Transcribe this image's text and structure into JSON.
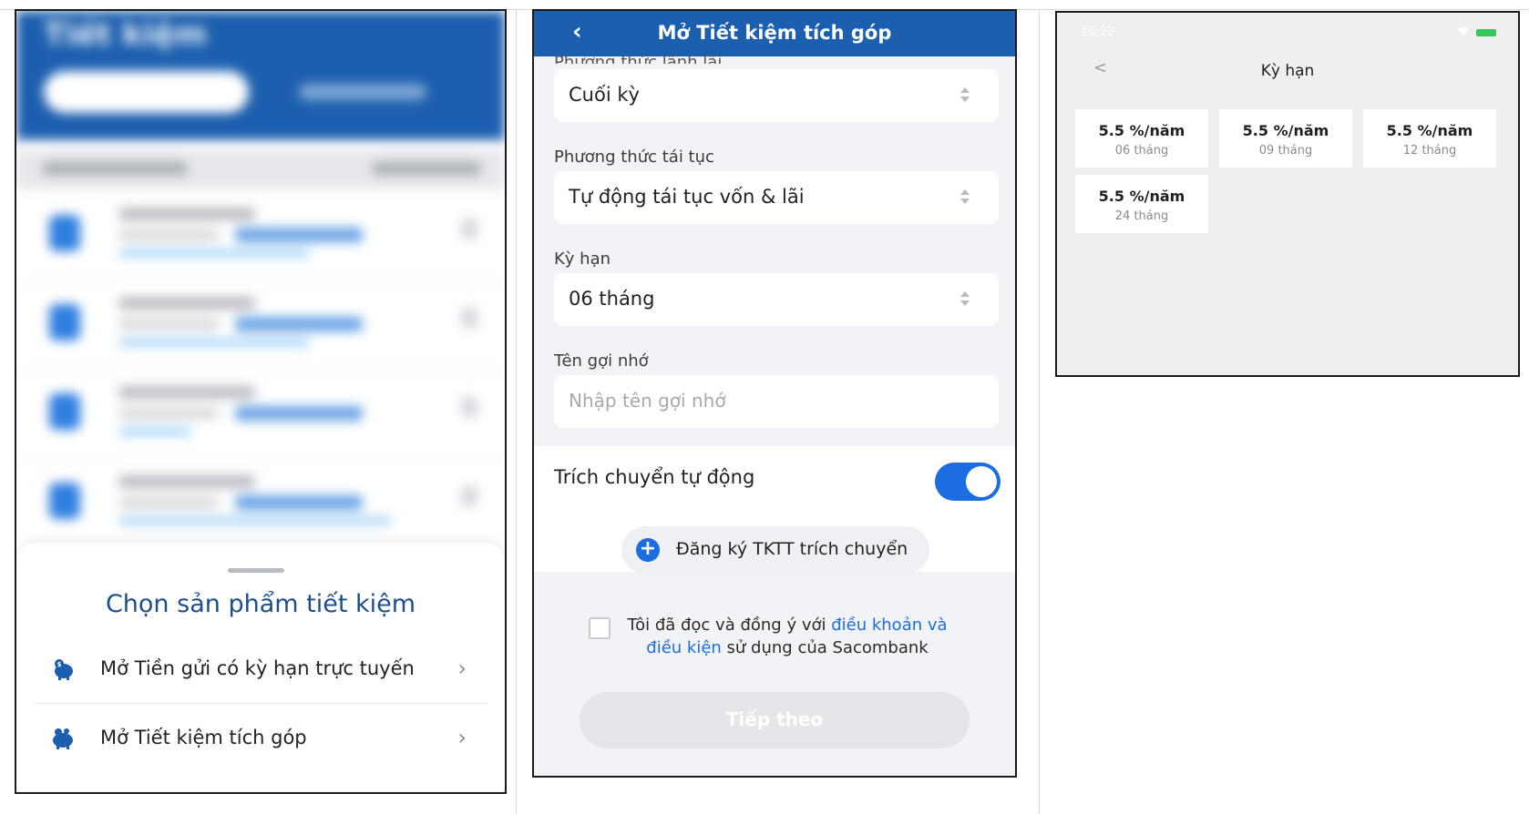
{
  "screen1": {
    "header_title": "Tiết kiệm",
    "sheet": {
      "title": "Chọn sản phẩm tiết kiệm",
      "options": [
        {
          "label": "Mở Tiền gửi có kỳ hạn trực tuyến",
          "icon": "piggy-bank-icon"
        },
        {
          "label": "Mở Tiết kiệm tích góp",
          "icon": "piggy-bank-icon"
        }
      ]
    },
    "arrow_glyph": "›"
  },
  "screen2": {
    "header": {
      "title": "Mở Tiết kiệm tích góp",
      "back_glyph": "‹"
    },
    "fields": {
      "payout_label_cut": "Phương thức lãnh lãi",
      "payout_value": "Cuối kỳ",
      "renewal_label": "Phương thức tái tục",
      "renewal_value": "Tự động tái tục vốn & lãi",
      "term_label": "Kỳ hạn",
      "term_value": "06 tháng",
      "nickname_label": "Tên gợi nhớ",
      "nickname_placeholder": "Nhập tên gợi nhớ"
    },
    "auto_transfer": {
      "label": "Trích chuyển tự động",
      "enabled": true,
      "register_button": "Đăng ký TKTT trích chuyển",
      "plus_glyph": "+"
    },
    "terms": {
      "prefix": "Tôi đã đọc và đồng ý với ",
      "link": "điều khoản và điều kiện",
      "suffix": " sử dụng của Sacombank",
      "checked": false
    },
    "next_button": "Tiếp theo",
    "colors": {
      "brand": "#1c5fae",
      "accent": "#1c6ee0"
    }
  },
  "screen3": {
    "status_time": "16:22",
    "back_glyph": "<",
    "title": "Kỳ hạn",
    "options": [
      {
        "rate": "5.5 %/năm",
        "term": "06 tháng"
      },
      {
        "rate": "5.5 %/năm",
        "term": "09 tháng"
      },
      {
        "rate": "5.5 %/năm",
        "term": "12 tháng"
      },
      {
        "rate": "5.5 %/năm",
        "term": "24 tháng"
      }
    ]
  }
}
